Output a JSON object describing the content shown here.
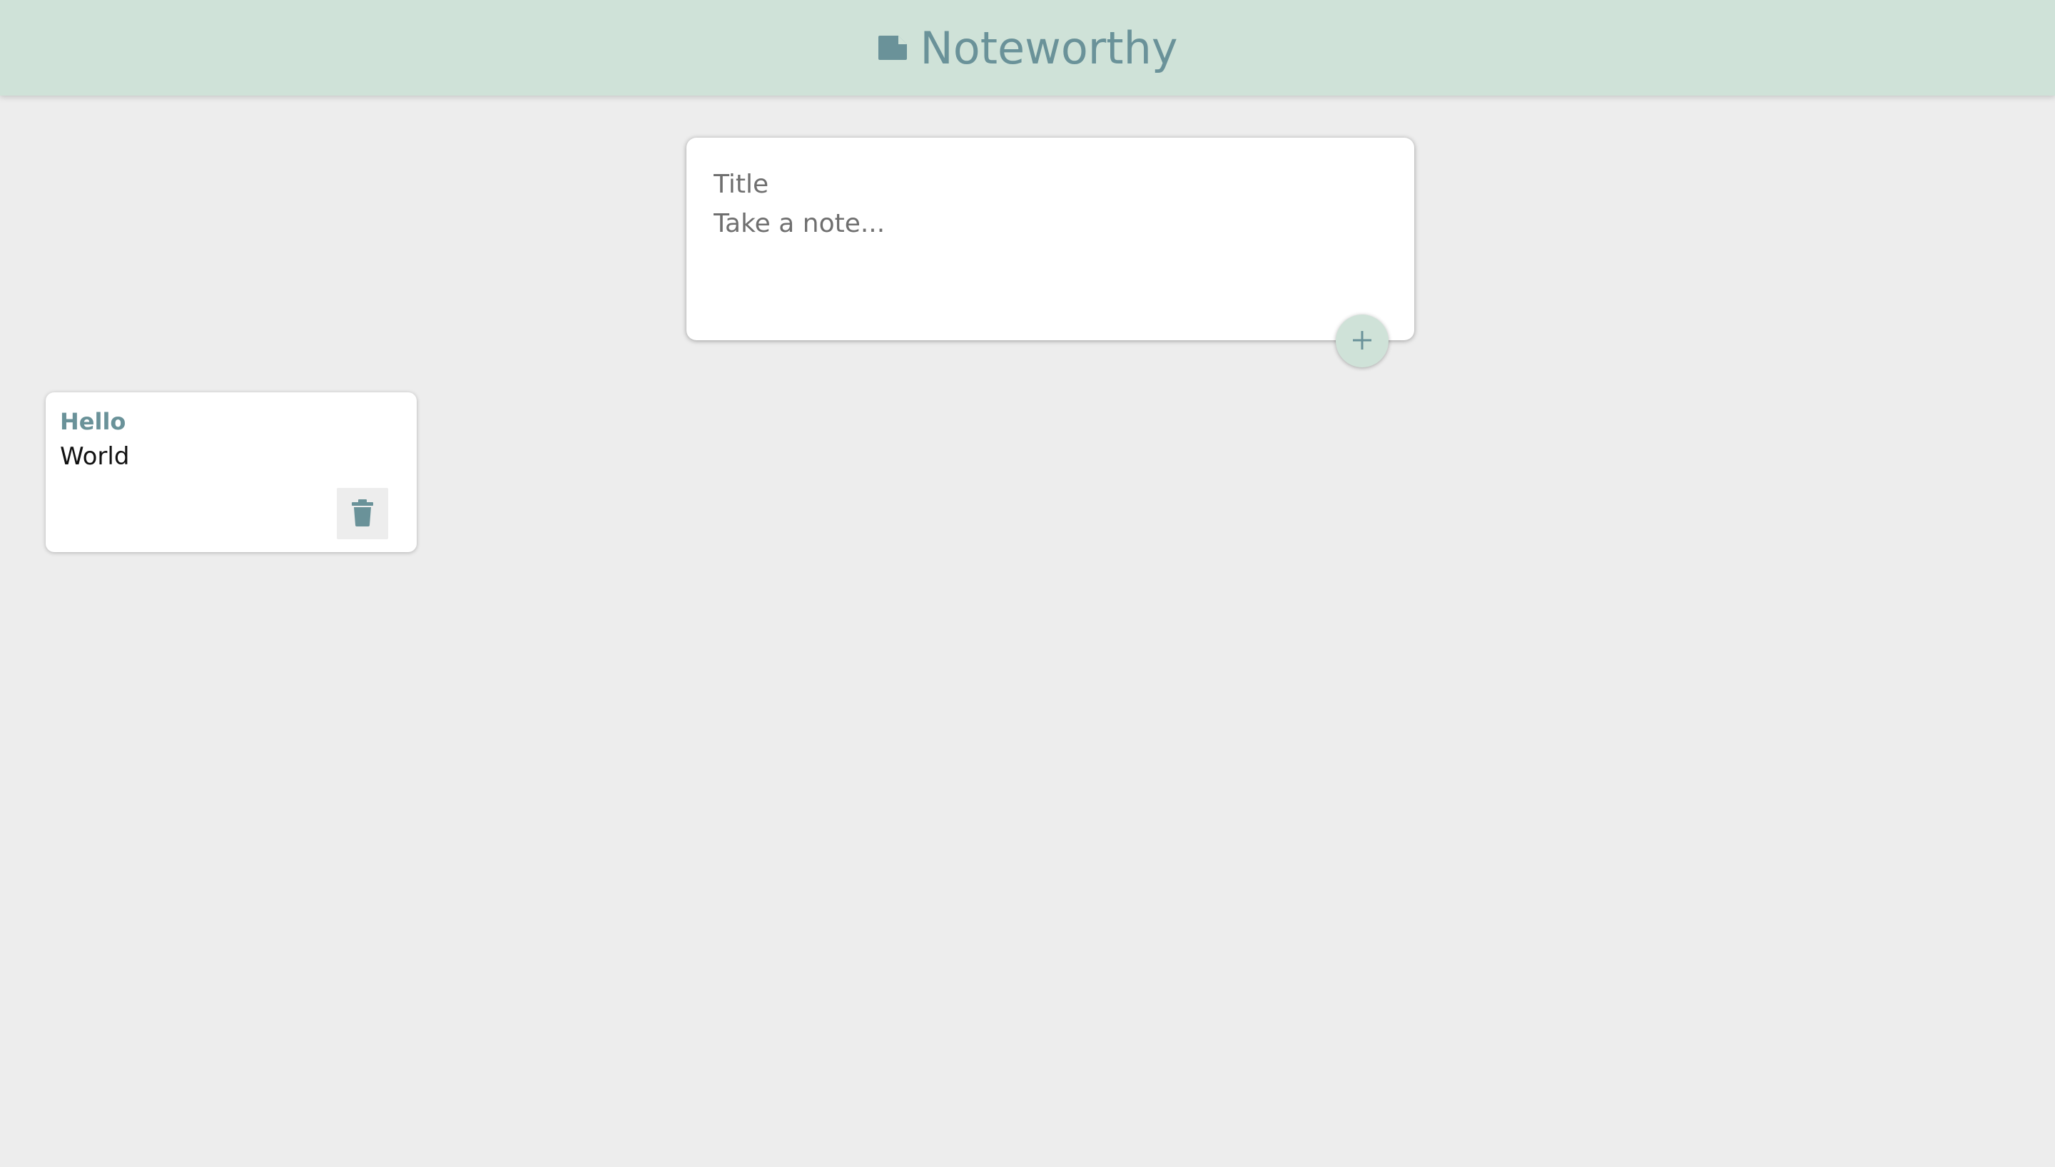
{
  "header": {
    "title": "Noteworthy",
    "icon": "label-icon"
  },
  "composer": {
    "title_placeholder": "Title",
    "title_value": "",
    "body_placeholder": "Take a note...",
    "body_value": "",
    "add_icon": "plus-icon"
  },
  "notes": [
    {
      "title": "Hello",
      "content": "World",
      "delete_icon": "trash-icon"
    }
  ],
  "colors": {
    "header_bg": "#cfe2d8",
    "accent": "#6a9299",
    "page_bg": "#ededed",
    "card_bg": "#ffffff"
  }
}
